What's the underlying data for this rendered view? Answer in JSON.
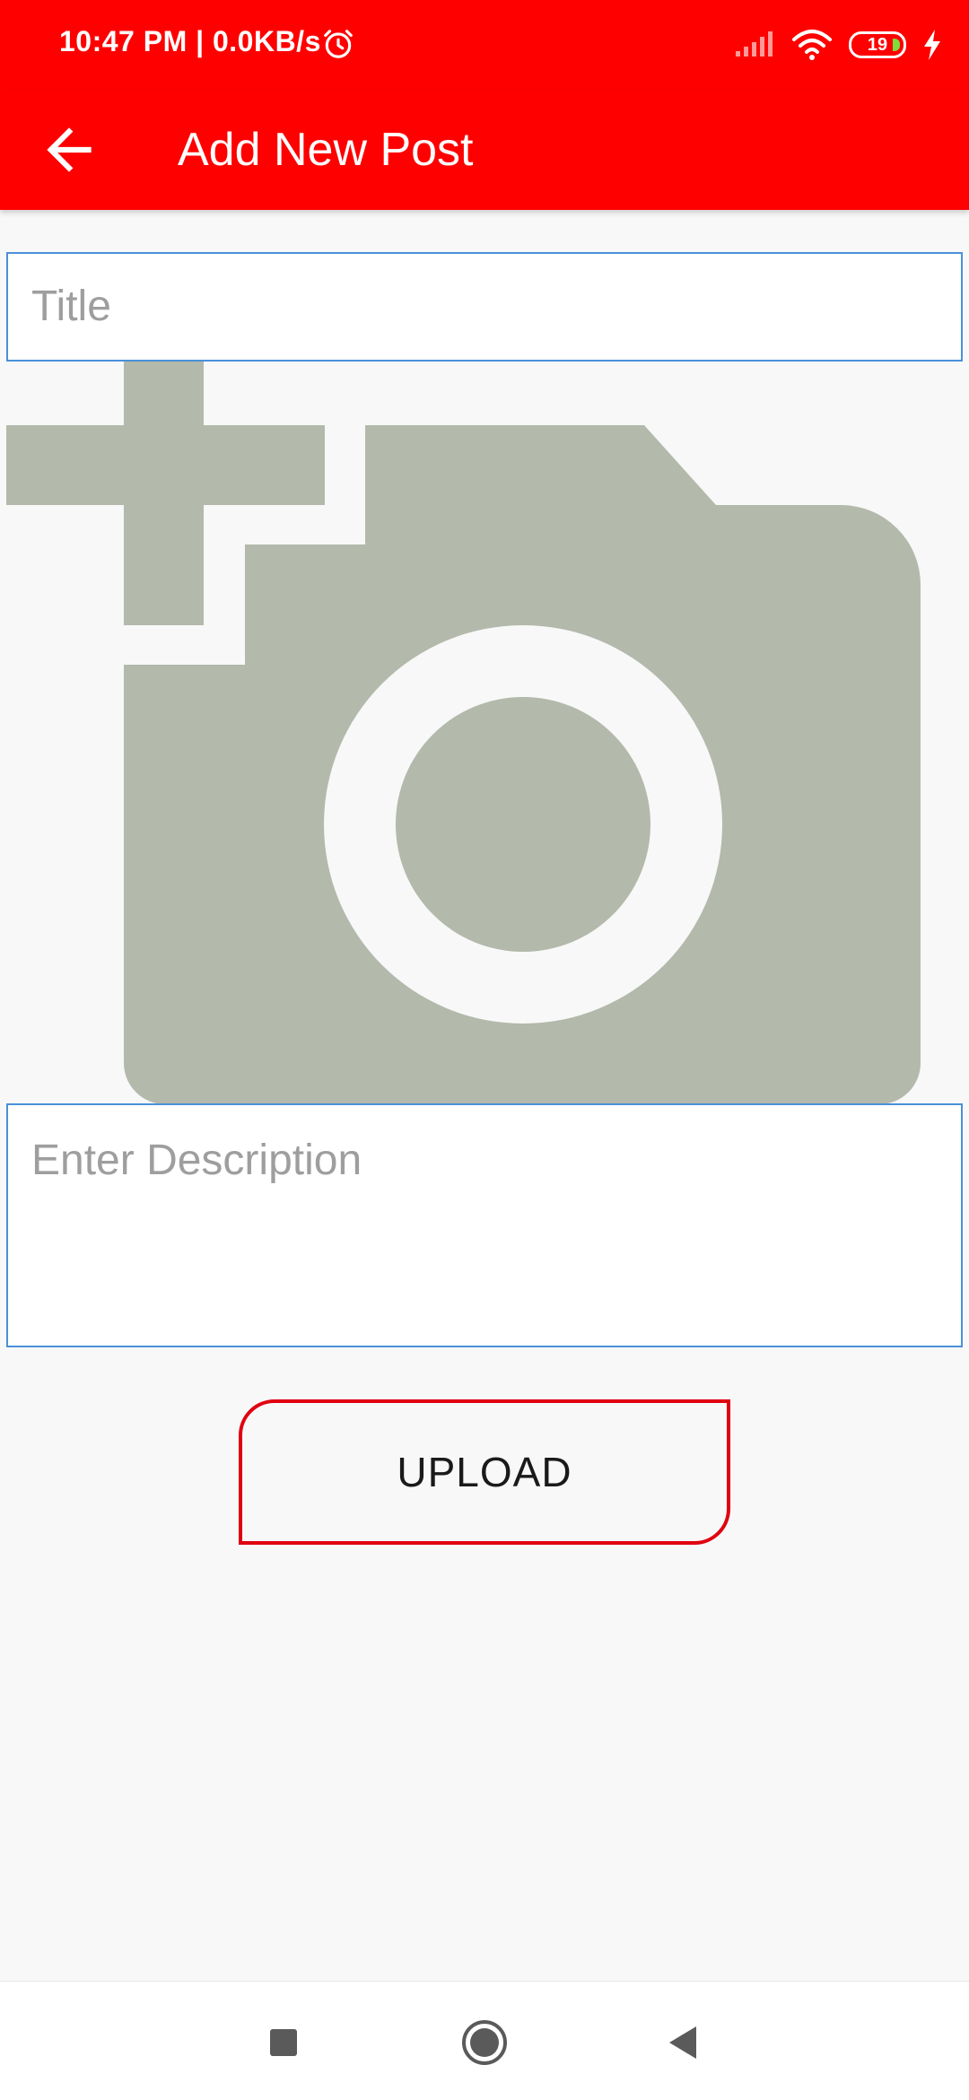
{
  "status_bar": {
    "time": "10:47 PM | 0.0KB/s",
    "battery_level": "19",
    "icons": [
      "alarm-icon",
      "signal-icon",
      "wifi-icon",
      "battery-icon",
      "charging-icon"
    ]
  },
  "app_bar": {
    "title": "Add New Post",
    "back_icon": "arrow-back-icon",
    "background": "#ff0000"
  },
  "form": {
    "title_placeholder": "Title",
    "image_placeholder_icon": "add-photo-icon",
    "description_placeholder": "Enter Description",
    "upload_label": "UPLOAD"
  },
  "nav_bar": {
    "icons": [
      "recents-square-icon",
      "home-circle-icon",
      "back-triangle-icon"
    ]
  },
  "colors": {
    "accent": "#ff0000",
    "input_border": "#4a90d9",
    "button_border": "#e00010",
    "placeholder_icon": "#b3b9ab"
  }
}
